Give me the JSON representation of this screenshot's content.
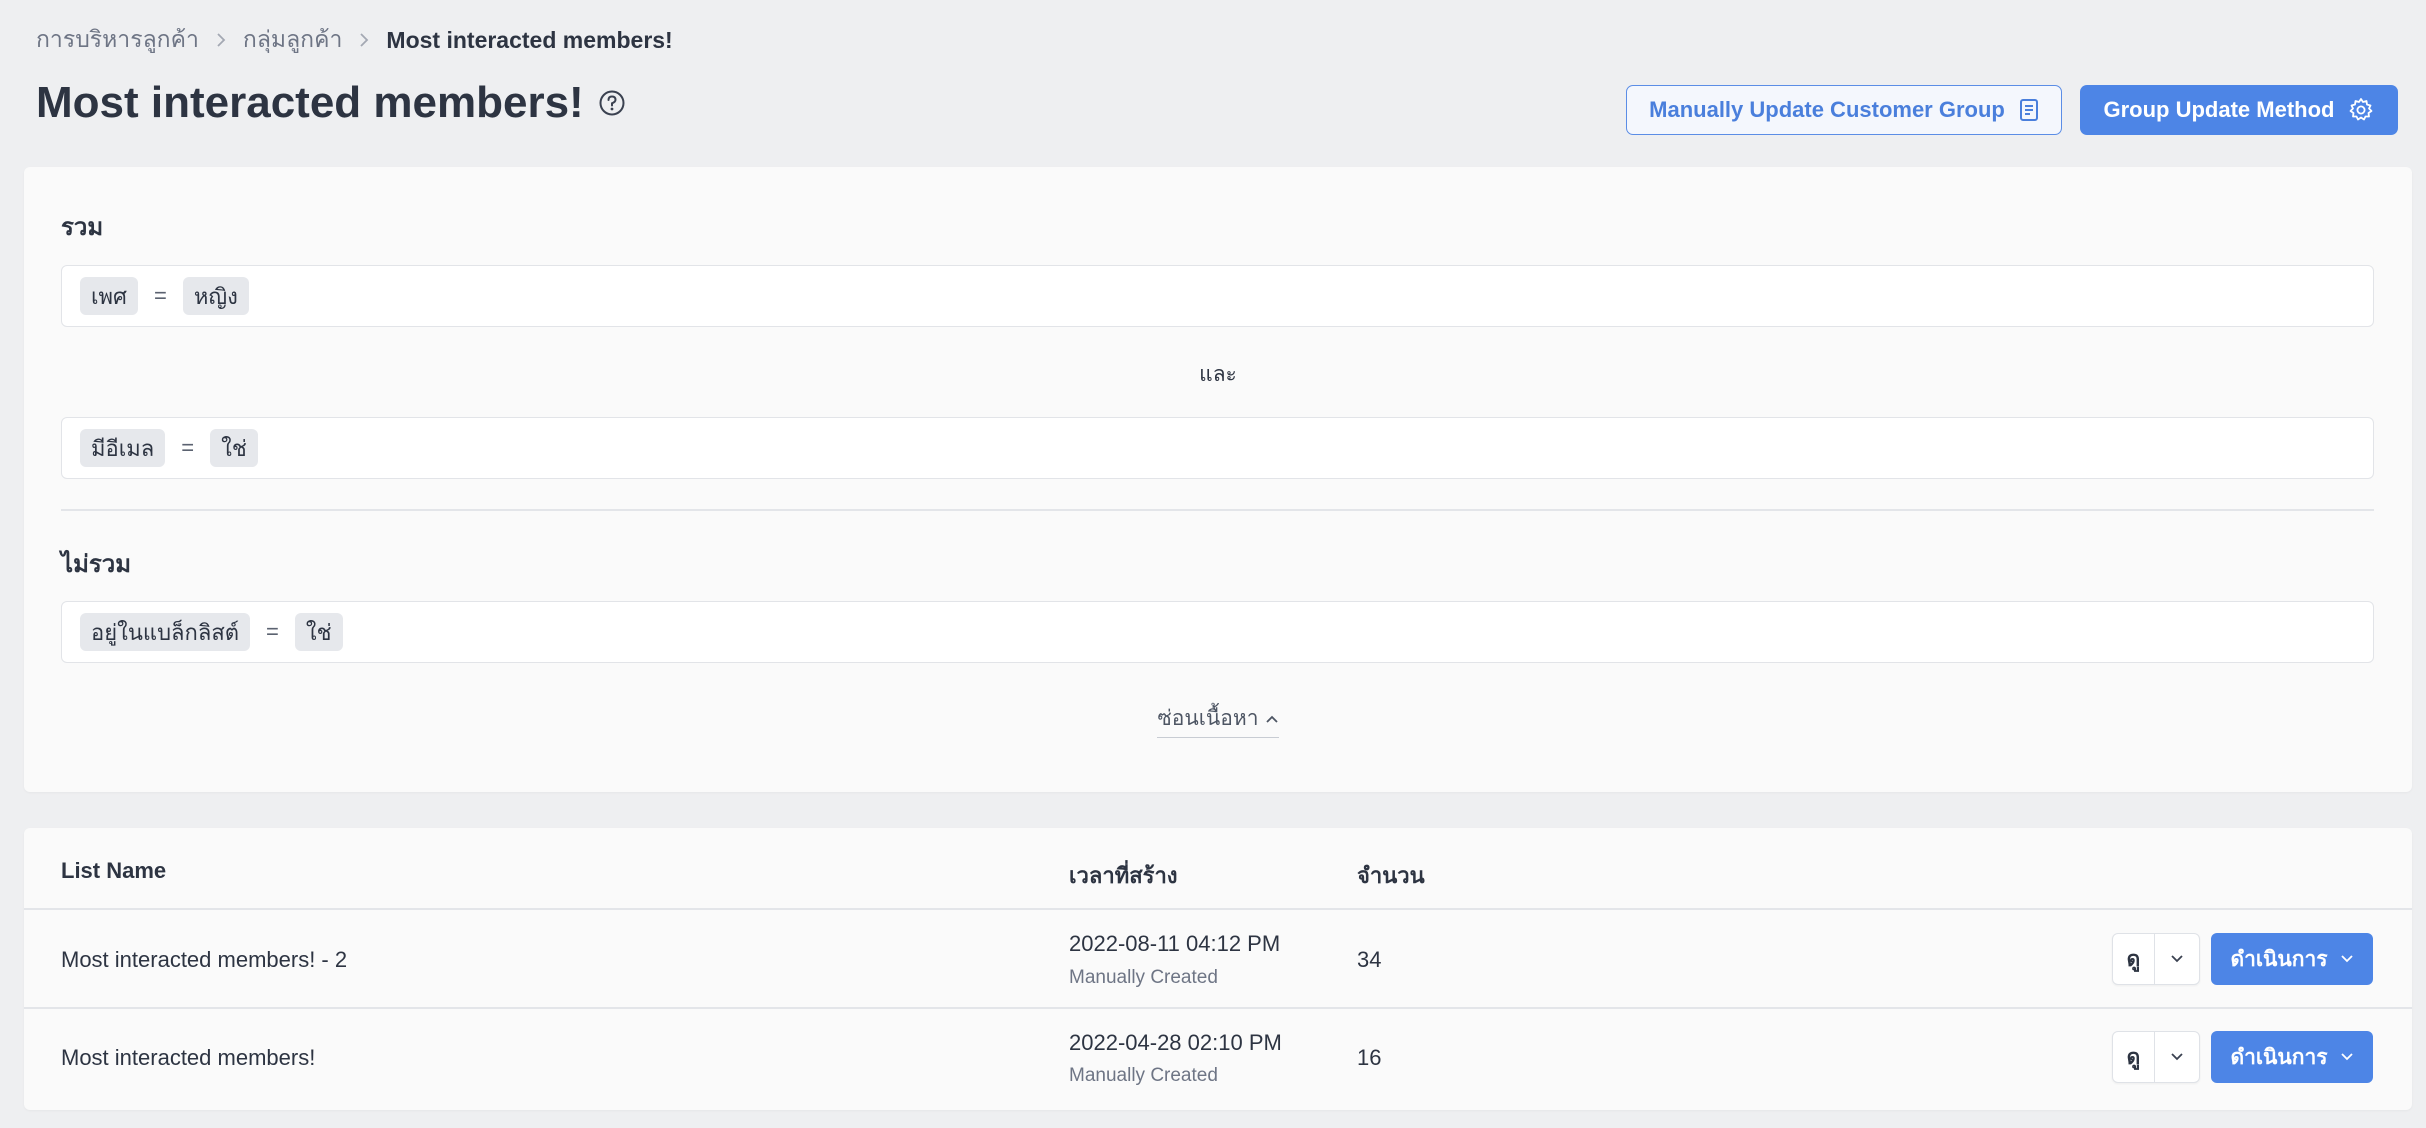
{
  "breadcrumb": {
    "items": [
      "การบริหารลูกค้า",
      "กลุ่มลูกค้า",
      "Most interacted members!"
    ]
  },
  "page": {
    "title": "Most interacted members!"
  },
  "header_buttons": {
    "manual_update": "Manually Update Customer Group",
    "group_update_method": "Group Update Method"
  },
  "filters": {
    "include_label": "รวม",
    "include_rules": [
      {
        "field": "เพศ",
        "operator": "=",
        "value": "หญิง"
      },
      {
        "field": "มีอีเมล",
        "operator": "=",
        "value": "ใช่"
      }
    ],
    "conjunction": "และ",
    "exclude_label": "ไม่รวม",
    "exclude_rules": [
      {
        "field": "อยู่ในแบล็กลิสต์",
        "operator": "=",
        "value": "ใช่"
      }
    ],
    "hide_link": "ซ่อนเนื้อหา"
  },
  "table": {
    "columns": [
      "List Name",
      "เวลาที่สร้าง",
      "จำนวน"
    ],
    "rows": [
      {
        "name": "Most interacted members! - 2",
        "created": "2022-08-11 04:12 PM",
        "created_note": "Manually Created",
        "count": "34",
        "view_label": "ดู",
        "action_label": "ดำเนินการ"
      },
      {
        "name": "Most interacted members!",
        "created": "2022-04-28 02:10 PM",
        "created_note": "Manually Created",
        "count": "16",
        "view_label": "ดู",
        "action_label": "ดำเนินการ"
      }
    ]
  },
  "colors": {
    "accent": "#4d85e6",
    "background": "#eeeff1",
    "card": "#fafafa",
    "text": "#2d3442"
  }
}
